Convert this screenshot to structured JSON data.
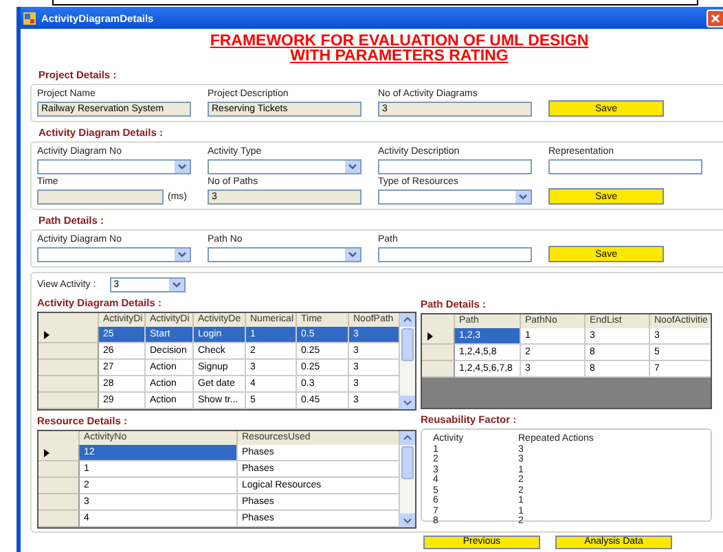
{
  "window": {
    "title": "ActivityDiagramDetails"
  },
  "heading": [
    "FRAMEWORK FOR EVALUATION OF UML DESIGN",
    "WITH PARAMETERS RATING"
  ],
  "project": {
    "title": "Project Details :",
    "fields": [
      {
        "label": "Project Name",
        "kind": "text",
        "value": "Railway Reservation System",
        "disabled": true
      },
      {
        "label": "Project Description",
        "kind": "text",
        "value": "Reserving Tickets",
        "disabled": true
      },
      {
        "label": "No of Activity Diagrams",
        "kind": "text",
        "value": "3",
        "disabled": true
      }
    ],
    "button": "Save"
  },
  "activity": {
    "title": "Activity Diagram Details :",
    "fields": [
      {
        "label": "Activity Diagram No",
        "kind": "combo",
        "disabled": false
      },
      {
        "label": "Activity Type",
        "kind": "combo",
        "disabled": false
      },
      {
        "label": "Activity Description",
        "kind": "text",
        "disabled": false
      },
      {
        "label": "Representation",
        "kind": "text",
        "disabled": false
      },
      {
        "label": "Time",
        "kind": "text",
        "disabled": true,
        "suffix": "(ms)"
      },
      {
        "label": "No of Paths",
        "kind": "text",
        "value": "3",
        "disabled": true
      },
      {
        "label": "Type of Resources",
        "kind": "combo",
        "disabled": false
      }
    ],
    "button": "Save"
  },
  "path": {
    "title": "Path Details :",
    "fields": [
      {
        "label": "Activity Diagram No",
        "kind": "combo",
        "disabled": false
      },
      {
        "label": "Path No",
        "kind": "combo",
        "disabled": false
      },
      {
        "label": "Path",
        "kind": "text",
        "disabled": false
      }
    ],
    "button": "Save"
  },
  "view_activity": {
    "label": "View Activity :",
    "value": "3"
  },
  "activity_table": {
    "title": "Activity Diagram Details :",
    "columns": [
      "ActivityDi",
      "ActivityDi",
      "ActivityDe",
      "Numerical",
      "Time",
      "NoofPath"
    ],
    "rows": [
      {
        "selected": true,
        "cells": [
          {
            "text": "25",
            "selected": true
          },
          {
            "text": "Start",
            "selected": true
          },
          {
            "text": "Login",
            "selected": true
          },
          {
            "text": "1",
            "selected": true
          },
          {
            "text": "0.5",
            "selected": true
          },
          {
            "text": "3",
            "selected": true
          }
        ]
      },
      {
        "selected": false,
        "cells": [
          {
            "text": "26",
            "selected": false
          },
          {
            "text": "Decision",
            "selected": false
          },
          {
            "text": "Check",
            "selected": false
          },
          {
            "text": "2",
            "selected": false
          },
          {
            "text": "0.25",
            "selected": false
          },
          {
            "text": "3",
            "selected": false
          }
        ]
      },
      {
        "selected": false,
        "cells": [
          {
            "text": "27",
            "selected": false
          },
          {
            "text": "Action",
            "selected": false
          },
          {
            "text": "Signup",
            "selected": false
          },
          {
            "text": "3",
            "selected": false
          },
          {
            "text": "0.25",
            "selected": false
          },
          {
            "text": "3",
            "selected": false
          }
        ]
      },
      {
        "selected": false,
        "cells": [
          {
            "text": "28",
            "selected": false
          },
          {
            "text": "Action",
            "selected": false
          },
          {
            "text": "Get date",
            "selected": false
          },
          {
            "text": "4",
            "selected": false
          },
          {
            "text": "0.3",
            "selected": false
          },
          {
            "text": "3",
            "selected": false
          }
        ]
      },
      {
        "selected": false,
        "cells": [
          {
            "text": "29",
            "selected": false
          },
          {
            "text": "Action",
            "selected": false
          },
          {
            "text": "Show tr...",
            "selected": false
          },
          {
            "text": "5",
            "selected": false
          },
          {
            "text": "0.45",
            "selected": false
          },
          {
            "text": "3",
            "selected": false
          }
        ]
      }
    ]
  },
  "path_table": {
    "title": "Path Details :",
    "columns": [
      "Path",
      "PathNo",
      "EndList",
      "NoofActivitie"
    ],
    "rows": [
      {
        "selected": true,
        "cells": [
          {
            "text": "1,2,3",
            "selected": true
          },
          {
            "text": "1",
            "selected": false
          },
          {
            "text": "3",
            "selected": false
          },
          {
            "text": "3",
            "selected": false
          }
        ]
      },
      {
        "selected": false,
        "cells": [
          {
            "text": "1,2,4,5,8",
            "selected": false
          },
          {
            "text": "2",
            "selected": false
          },
          {
            "text": "8",
            "selected": false
          },
          {
            "text": "5",
            "selected": false
          }
        ]
      },
      {
        "selected": false,
        "cells": [
          {
            "text": "1,2,4,5,6,7,8",
            "selected": false
          },
          {
            "text": "3",
            "selected": false
          },
          {
            "text": "8",
            "selected": false
          },
          {
            "text": "7",
            "selected": false
          }
        ]
      }
    ]
  },
  "resource_table": {
    "title": "Resource Details :",
    "columns": [
      "ActivityNo",
      "ResourcesUsed"
    ],
    "rows": [
      {
        "selected": true,
        "cells": [
          {
            "text": "12",
            "selected": true
          },
          {
            "text": "Phases",
            "selected": false
          }
        ]
      },
      {
        "selected": false,
        "cells": [
          {
            "text": "1",
            "selected": false
          },
          {
            "text": "Phases",
            "selected": false
          }
        ]
      },
      {
        "selected": false,
        "cells": [
          {
            "text": "2",
            "selected": false
          },
          {
            "text": "Logical Resources",
            "selected": false
          }
        ]
      },
      {
        "selected": false,
        "cells": [
          {
            "text": "3",
            "selected": false
          },
          {
            "text": "Phases",
            "selected": false
          }
        ]
      },
      {
        "selected": false,
        "cells": [
          {
            "text": "4",
            "selected": false
          },
          {
            "text": "Phases",
            "selected": false
          }
        ]
      }
    ]
  },
  "reusability": {
    "title": "Reusability Factor  :",
    "columns": [
      "Activity",
      "Repeated Actions"
    ],
    "rows": [
      [
        "1",
        "3"
      ],
      [
        "2",
        "3"
      ],
      [
        "3",
        "1"
      ],
      [
        "4",
        "2"
      ],
      [
        "5",
        "2"
      ],
      [
        "6",
        "1"
      ],
      [
        "7",
        "1"
      ],
      [
        "8",
        "2"
      ]
    ]
  },
  "buttons": [
    "Previous",
    "Analysis Data"
  ]
}
